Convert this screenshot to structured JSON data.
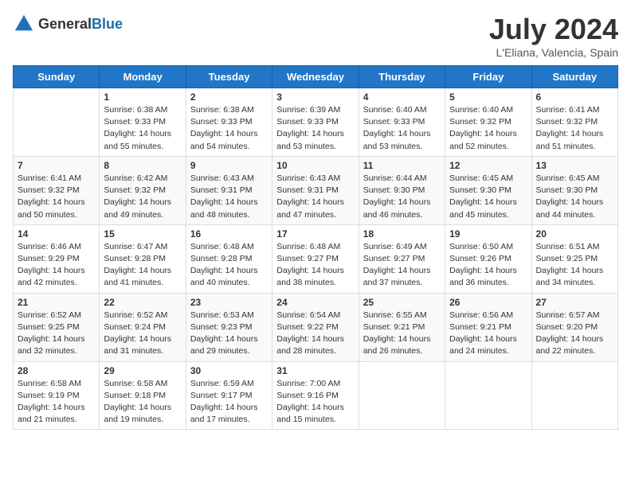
{
  "header": {
    "logo_general": "General",
    "logo_blue": "Blue",
    "month_title": "July 2024",
    "subtitle": "L'Eliana, Valencia, Spain"
  },
  "calendar": {
    "days_of_week": [
      "Sunday",
      "Monday",
      "Tuesday",
      "Wednesday",
      "Thursday",
      "Friday",
      "Saturday"
    ],
    "weeks": [
      [
        {
          "day": "",
          "info": ""
        },
        {
          "day": "1",
          "info": "Sunrise: 6:38 AM\nSunset: 9:33 PM\nDaylight: 14 hours\nand 55 minutes."
        },
        {
          "day": "2",
          "info": "Sunrise: 6:38 AM\nSunset: 9:33 PM\nDaylight: 14 hours\nand 54 minutes."
        },
        {
          "day": "3",
          "info": "Sunrise: 6:39 AM\nSunset: 9:33 PM\nDaylight: 14 hours\nand 53 minutes."
        },
        {
          "day": "4",
          "info": "Sunrise: 6:40 AM\nSunset: 9:33 PM\nDaylight: 14 hours\nand 53 minutes."
        },
        {
          "day": "5",
          "info": "Sunrise: 6:40 AM\nSunset: 9:32 PM\nDaylight: 14 hours\nand 52 minutes."
        },
        {
          "day": "6",
          "info": "Sunrise: 6:41 AM\nSunset: 9:32 PM\nDaylight: 14 hours\nand 51 minutes."
        }
      ],
      [
        {
          "day": "7",
          "info": "Sunrise: 6:41 AM\nSunset: 9:32 PM\nDaylight: 14 hours\nand 50 minutes."
        },
        {
          "day": "8",
          "info": "Sunrise: 6:42 AM\nSunset: 9:32 PM\nDaylight: 14 hours\nand 49 minutes."
        },
        {
          "day": "9",
          "info": "Sunrise: 6:43 AM\nSunset: 9:31 PM\nDaylight: 14 hours\nand 48 minutes."
        },
        {
          "day": "10",
          "info": "Sunrise: 6:43 AM\nSunset: 9:31 PM\nDaylight: 14 hours\nand 47 minutes."
        },
        {
          "day": "11",
          "info": "Sunrise: 6:44 AM\nSunset: 9:30 PM\nDaylight: 14 hours\nand 46 minutes."
        },
        {
          "day": "12",
          "info": "Sunrise: 6:45 AM\nSunset: 9:30 PM\nDaylight: 14 hours\nand 45 minutes."
        },
        {
          "day": "13",
          "info": "Sunrise: 6:45 AM\nSunset: 9:30 PM\nDaylight: 14 hours\nand 44 minutes."
        }
      ],
      [
        {
          "day": "14",
          "info": "Sunrise: 6:46 AM\nSunset: 9:29 PM\nDaylight: 14 hours\nand 42 minutes."
        },
        {
          "day": "15",
          "info": "Sunrise: 6:47 AM\nSunset: 9:28 PM\nDaylight: 14 hours\nand 41 minutes."
        },
        {
          "day": "16",
          "info": "Sunrise: 6:48 AM\nSunset: 9:28 PM\nDaylight: 14 hours\nand 40 minutes."
        },
        {
          "day": "17",
          "info": "Sunrise: 6:48 AM\nSunset: 9:27 PM\nDaylight: 14 hours\nand 38 minutes."
        },
        {
          "day": "18",
          "info": "Sunrise: 6:49 AM\nSunset: 9:27 PM\nDaylight: 14 hours\nand 37 minutes."
        },
        {
          "day": "19",
          "info": "Sunrise: 6:50 AM\nSunset: 9:26 PM\nDaylight: 14 hours\nand 36 minutes."
        },
        {
          "day": "20",
          "info": "Sunrise: 6:51 AM\nSunset: 9:25 PM\nDaylight: 14 hours\nand 34 minutes."
        }
      ],
      [
        {
          "day": "21",
          "info": "Sunrise: 6:52 AM\nSunset: 9:25 PM\nDaylight: 14 hours\nand 32 minutes."
        },
        {
          "day": "22",
          "info": "Sunrise: 6:52 AM\nSunset: 9:24 PM\nDaylight: 14 hours\nand 31 minutes."
        },
        {
          "day": "23",
          "info": "Sunrise: 6:53 AM\nSunset: 9:23 PM\nDaylight: 14 hours\nand 29 minutes."
        },
        {
          "day": "24",
          "info": "Sunrise: 6:54 AM\nSunset: 9:22 PM\nDaylight: 14 hours\nand 28 minutes."
        },
        {
          "day": "25",
          "info": "Sunrise: 6:55 AM\nSunset: 9:21 PM\nDaylight: 14 hours\nand 26 minutes."
        },
        {
          "day": "26",
          "info": "Sunrise: 6:56 AM\nSunset: 9:21 PM\nDaylight: 14 hours\nand 24 minutes."
        },
        {
          "day": "27",
          "info": "Sunrise: 6:57 AM\nSunset: 9:20 PM\nDaylight: 14 hours\nand 22 minutes."
        }
      ],
      [
        {
          "day": "28",
          "info": "Sunrise: 6:58 AM\nSunset: 9:19 PM\nDaylight: 14 hours\nand 21 minutes."
        },
        {
          "day": "29",
          "info": "Sunrise: 6:58 AM\nSunset: 9:18 PM\nDaylight: 14 hours\nand 19 minutes."
        },
        {
          "day": "30",
          "info": "Sunrise: 6:59 AM\nSunset: 9:17 PM\nDaylight: 14 hours\nand 17 minutes."
        },
        {
          "day": "31",
          "info": "Sunrise: 7:00 AM\nSunset: 9:16 PM\nDaylight: 14 hours\nand 15 minutes."
        },
        {
          "day": "",
          "info": ""
        },
        {
          "day": "",
          "info": ""
        },
        {
          "day": "",
          "info": ""
        }
      ]
    ]
  }
}
